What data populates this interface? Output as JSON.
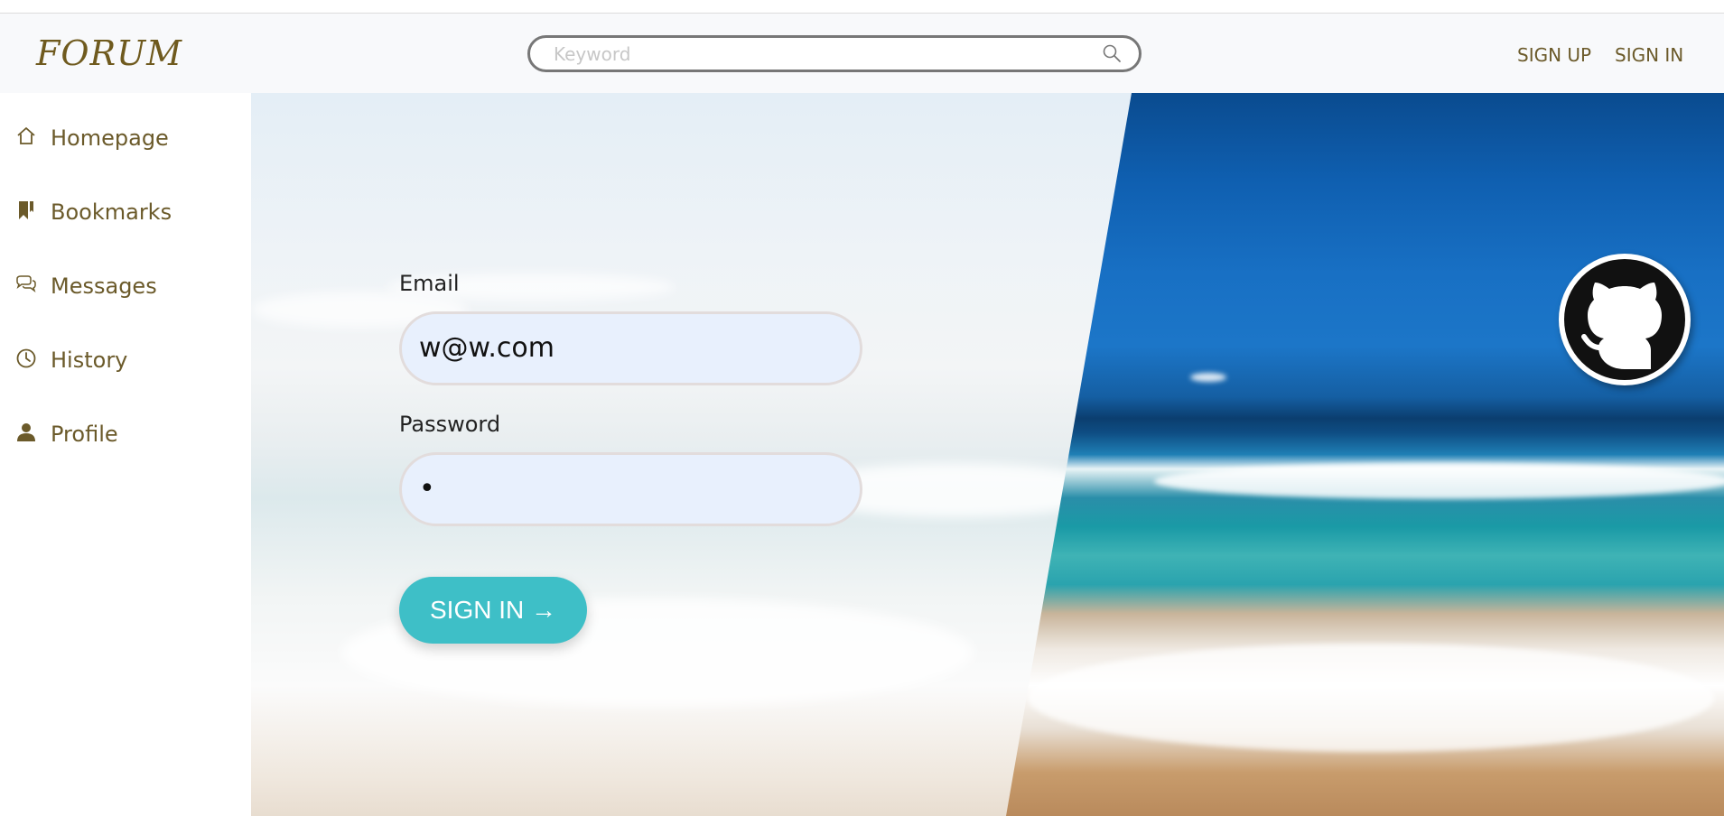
{
  "header": {
    "logo": "FORUM",
    "search": {
      "placeholder": "Keyword",
      "value": ""
    },
    "links": {
      "sign_up": "SIGN UP",
      "sign_in": "SIGN IN"
    }
  },
  "sidebar": {
    "items": [
      {
        "label": "Homepage",
        "icon": "home-icon"
      },
      {
        "label": "Bookmarks",
        "icon": "bookmark-icon"
      },
      {
        "label": "Messages",
        "icon": "messages-icon"
      },
      {
        "label": "History",
        "icon": "clock-icon"
      },
      {
        "label": "Profile",
        "icon": "user-icon"
      }
    ]
  },
  "form": {
    "email_label": "Email",
    "email_value": "w@w.com",
    "password_label": "Password",
    "password_value": "•",
    "submit_label": "SIGN IN →"
  },
  "colors": {
    "accent": "#3ebfc7",
    "brand_text": "#6b5a2a",
    "input_bg": "#e8f0fd"
  },
  "social": {
    "icon": "github-icon"
  }
}
